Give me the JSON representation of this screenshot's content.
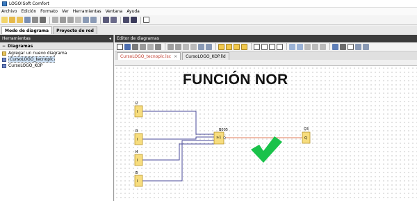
{
  "window": {
    "title": "LOGO!Soft Comfort"
  },
  "menu": [
    "Archivo",
    "Edición",
    "Formato",
    "Ver",
    "Herramientas",
    "Ventana",
    "Ayuda"
  ],
  "mode_tabs": [
    {
      "label": "Modo de diagrama",
      "active": true
    },
    {
      "label": "Proyecto de red",
      "active": false
    }
  ],
  "left_panel": {
    "header": "Herramientas",
    "collapse_glyph": "◂",
    "tree_title": "Diagramas",
    "items": [
      {
        "label": "Agregar un nuevo diagrama",
        "selected": false
      },
      {
        "label": "CursoLOGO_tecnoplc",
        "selected": true
      },
      {
        "label": "CursoLOGO_KOP",
        "selected": false
      }
    ]
  },
  "editor": {
    "header": "Editor de diagramas",
    "tabs": [
      {
        "label": "CursoLOGO_tecnoplc.lsc",
        "active": true
      },
      {
        "label": "CursoLOGO_KOP.lld",
        "active": false
      }
    ],
    "close_glyph": "×"
  },
  "diagram": {
    "title": "FUNCIÓN NOR",
    "inputs": [
      {
        "name": "I2",
        "symbol": "I"
      },
      {
        "name": "I3",
        "symbol": "I"
      },
      {
        "name": "I4",
        "symbol": "I"
      },
      {
        "name": "I5",
        "symbol": "I"
      }
    ],
    "gate": {
      "name": "B005",
      "symbol": "≥1"
    },
    "output": {
      "name": "Q3",
      "symbol": "Q"
    },
    "check_color": "#19c24a",
    "wire_color": "#4a4a9a",
    "output_wire_color": "#e07b5a"
  }
}
